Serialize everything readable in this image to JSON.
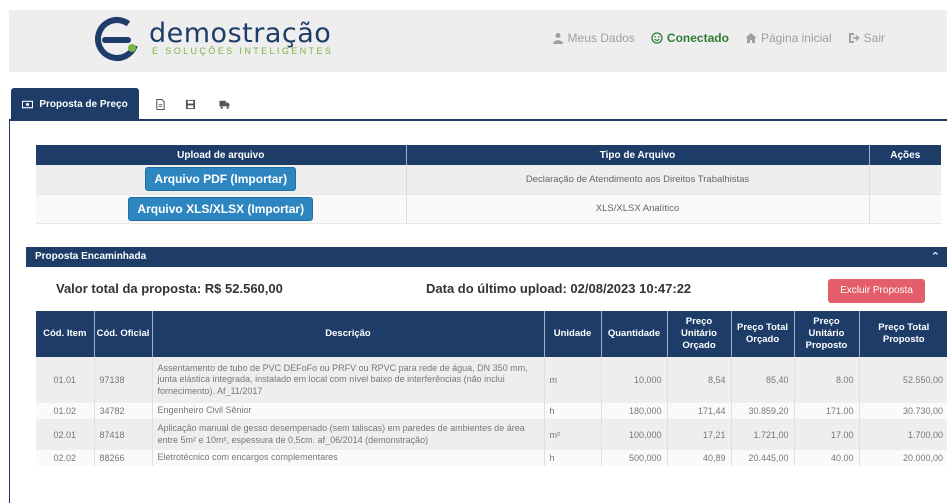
{
  "brand": {
    "title": "demostração",
    "subtitle": "E SOLUÇÕES INTELIGENTES",
    "primary_color": "#1d3c68",
    "accent_color": "#7cb342"
  },
  "topnav": {
    "my_data": "Meus Dados",
    "connected": "Conectado",
    "home": "Página inicial",
    "logout": "Sair"
  },
  "tabs": {
    "active_label": "Proposta de Preço",
    "icons": [
      "file-icon",
      "save-icon",
      "truck-icon"
    ]
  },
  "upload": {
    "headers": [
      "Upload de arquivo",
      "Tipo de Arquivo",
      "Ações"
    ],
    "rows": [
      {
        "button": "Arquivo PDF (Importar)",
        "type": "Declaração de Atendimento aos Direitos Trabalhistas",
        "actions": ""
      },
      {
        "button": "Arquivo XLS/XLSX (Importar)",
        "type": "XLS/XLSX Analítico",
        "actions": ""
      }
    ]
  },
  "panel": {
    "title": "Proposta Encaminhada",
    "total_label": "Valor total da proposta: R$ 52.560,00",
    "last_upload_label": "Data do último upload: 02/08/2023 10:47:22",
    "delete_button": "Excluir Proposta",
    "delete_color": "#e35d6a"
  },
  "items": {
    "headers": {
      "cod_item": "Cód. Item",
      "cod_oficial": "Cód. Oficial",
      "descricao": "Descrição",
      "unidade": "Unidade",
      "quantidade": "Quantidade",
      "preco_unit_orcado": "Preço Unitário Orçado",
      "preco_total_orcado": "Preço Total Orçado",
      "preco_unit_proposto": "Preço Unitário Proposto",
      "preco_total_proposto": "Preço Total Proposto"
    },
    "rows": [
      {
        "cod_item": "01.01",
        "cod_oficial": "97138",
        "descricao": "Assentamento de tubo de PVC DEFoFo ou PRFV ou RPVC para rede de água, DN 350 mm, junta elástica integrada, instalado em local com nível baixo de interferências (não inclui fornecimento). Af_11/2017",
        "unidade": "m",
        "quantidade": "10,000",
        "puo": "8,54",
        "pto": "85,40",
        "pup": "8.00",
        "ptp": "52.550,00"
      },
      {
        "cod_item": "01.02",
        "cod_oficial": "34782",
        "descricao": "Engenheiro Civil Sênior",
        "unidade": "h",
        "quantidade": "180,000",
        "puo": "171,44",
        "pto": "30.859,20",
        "pup": "171.00",
        "ptp": "30.730,00"
      },
      {
        "cod_item": "02.01",
        "cod_oficial": "87418",
        "descricao": "Aplicação manual de gesso desempenado (sem taliscas) em paredes de ambientes de área entre 5m² e 10m², espessura de 0,5cm. af_06/2014 (demonstração)",
        "unidade": "m²",
        "quantidade": "100,000",
        "puo": "17,21",
        "pto": "1.721,00",
        "pup": "17.00",
        "ptp": "1.700,00"
      },
      {
        "cod_item": "02.02",
        "cod_oficial": "88266",
        "descricao": "Eletrotécnico com encargos complementares",
        "unidade": "h",
        "quantidade": "500,000",
        "puo": "40,89",
        "pto": "20.445,00",
        "pup": "40.00",
        "ptp": "20.000,00"
      }
    ]
  }
}
